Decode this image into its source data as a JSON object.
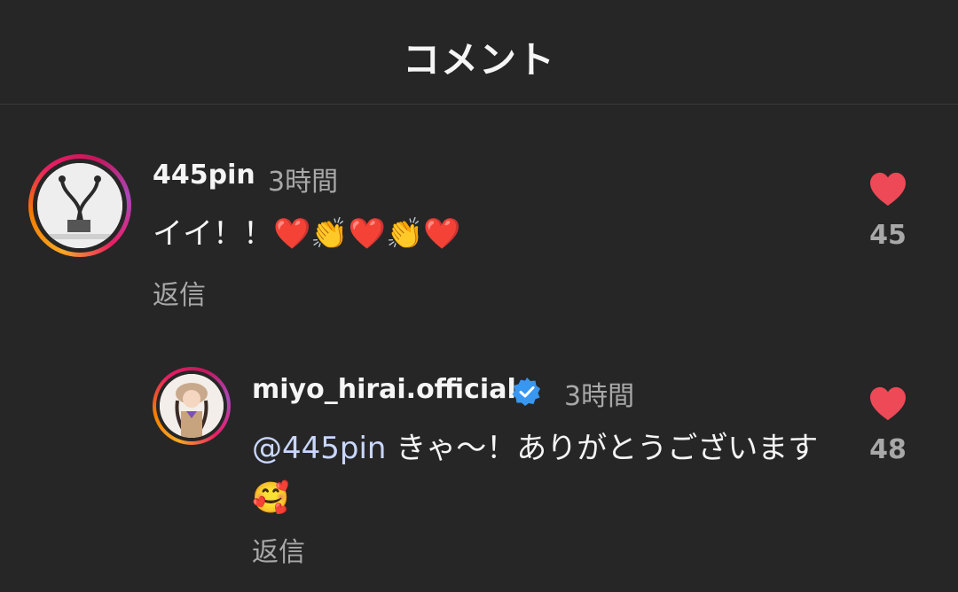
{
  "header": {
    "title": "コメント"
  },
  "comments": [
    {
      "username": "445pin",
      "time": "3時間",
      "text": "イイ！！❤️👏❤️👏❤️",
      "reply_label": "返信",
      "like_count": "45"
    },
    {
      "username": "miyo_hirai.official",
      "verified": true,
      "time": "3時間",
      "mention": "@445pin",
      "text": " きゃ〜！ありがとうございます🥰",
      "reply_label": "返信",
      "like_count": "48"
    }
  ],
  "colors": {
    "background": "#262626",
    "like_red": "#ed4956",
    "verified_blue": "#3897f0",
    "muted_text": "#a8a8a8"
  },
  "icons": {
    "like": "heart-icon",
    "verified": "verified-badge-icon"
  }
}
